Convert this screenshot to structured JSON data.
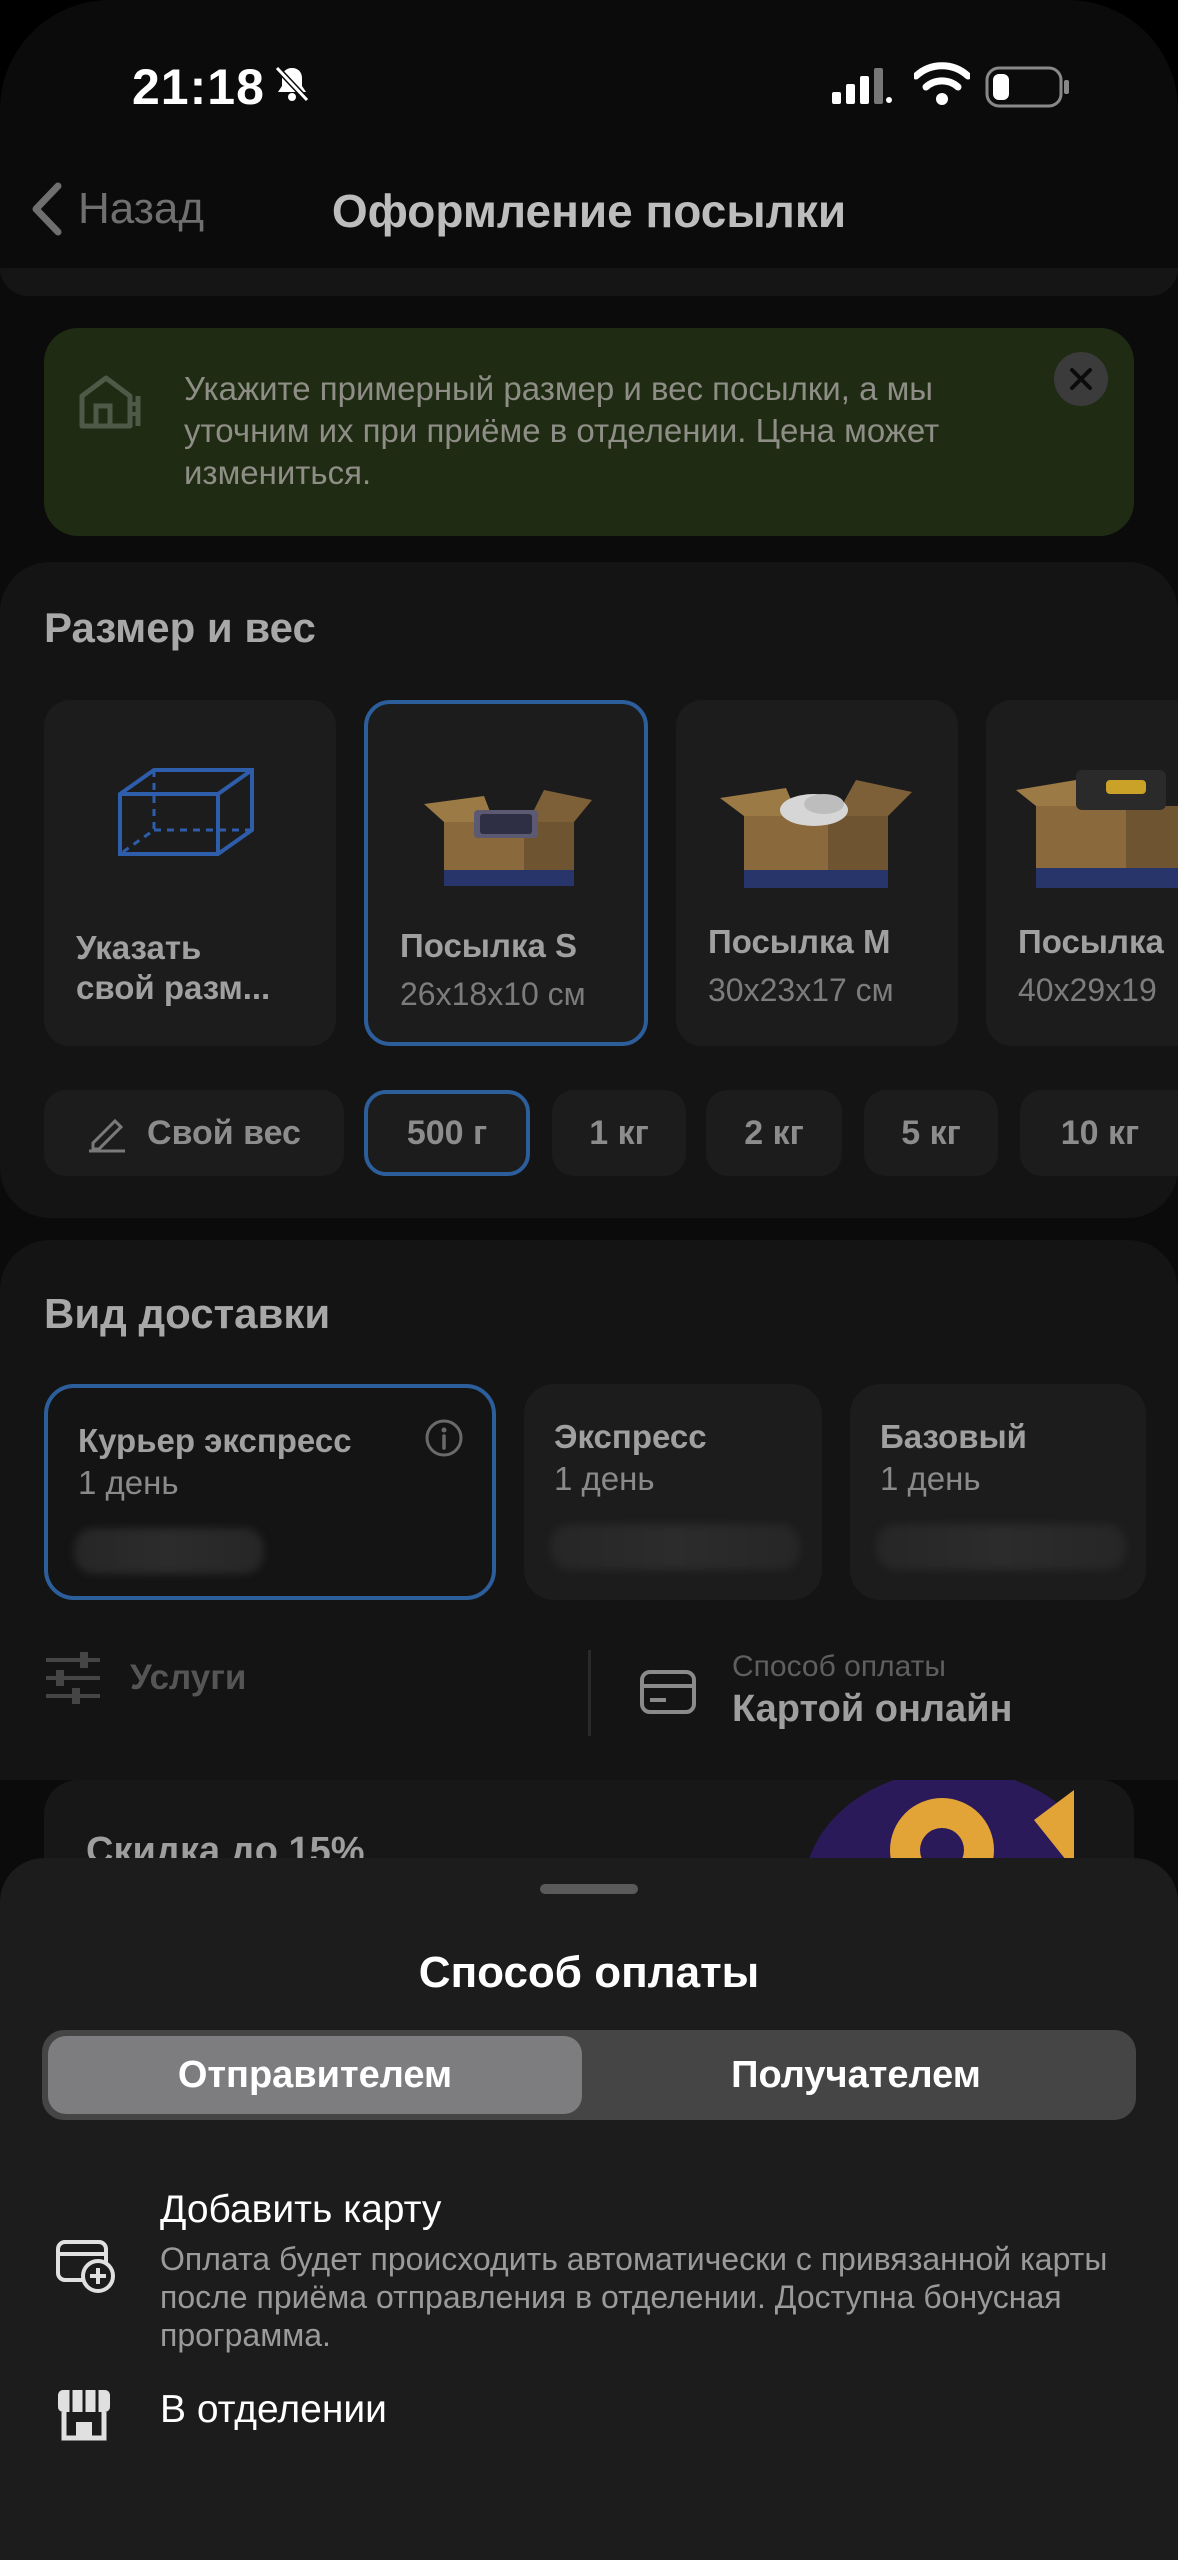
{
  "status_bar": {
    "time": "21:18"
  },
  "nav": {
    "back_label": "Назад",
    "title": "Оформление посылки"
  },
  "info_banner": {
    "text": "Укажите примерный размер и вес посылки, а мы уточним их при приёме в отделении. Цена может измениться."
  },
  "size_section": {
    "title": "Размер и вес",
    "options": [
      {
        "label": "Указать свой разм...",
        "dims": ""
      },
      {
        "label": "Посылка S",
        "dims": "26x18x10 см"
      },
      {
        "label": "Посылка M",
        "dims": "30x23x17 см"
      },
      {
        "label": "Посылка",
        "dims": "40x29x19"
      }
    ],
    "selected_option": "Посылка S",
    "weights": [
      "Свой вес",
      "500 г",
      "1 кг",
      "2 кг",
      "5 кг",
      "10 кг"
    ],
    "selected_weight": "500 г"
  },
  "delivery_section": {
    "title": "Вид доставки",
    "options": [
      {
        "name": "Курьер экспресс",
        "days": "1 день"
      },
      {
        "name": "Экспресс",
        "days": "1 день"
      },
      {
        "name": "Базовый",
        "days": "1 день"
      }
    ],
    "selected_option": "Курьер экспресс",
    "services_label": "Услуги",
    "payment_caption": "Способ оплаты",
    "payment_value": "Картой онлайн"
  },
  "promo": {
    "text": "Скидка до 15%"
  },
  "sheet": {
    "title": "Способ оплаты",
    "segments": [
      "Отправителем",
      "Получателем"
    ],
    "active_segment": "Отправителем",
    "options": [
      {
        "title": "Добавить карту",
        "description": "Оплата будет происходить автоматически с привязанной карты после приёма отправления в отделении. Доступна бонусная программа."
      },
      {
        "title": "В отделении"
      }
    ]
  },
  "colors": {
    "accent_border": "#2c5e9c",
    "banner_bg": "#1f2b13",
    "sheet_bg": "#1c1c1c",
    "segment_active": "#7d7d80"
  }
}
